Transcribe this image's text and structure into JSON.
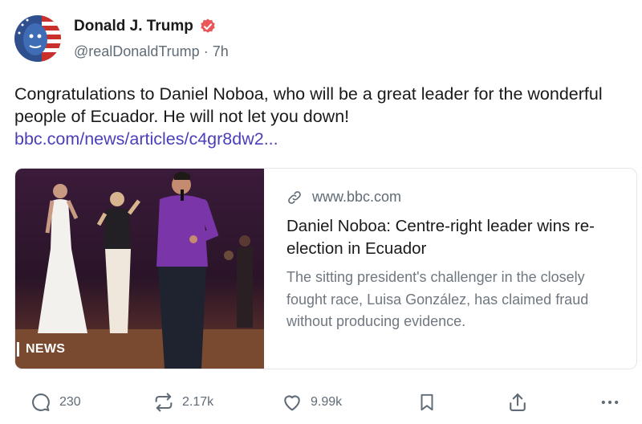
{
  "post": {
    "author_name": "Donald J. Trump",
    "handle": "@realDonaldTrump",
    "time": "7h",
    "text": "Congratulations to Daniel Noboa, who will be a great leader for the wonderful people of Ecuador. He will not let you down!",
    "link": "bbc.com/news/articles/c4gr8dw2..."
  },
  "card": {
    "domain": "www.bbc.com",
    "title": "Daniel Noboa: Centre-right leader wins re-election in Ecuador",
    "description": "The sitting president's challenger in the closely fought race, Luisa González, has claimed fraud without producing evidence.",
    "image_badge": "NEWS"
  },
  "actions": {
    "replies": "230",
    "reposts": "2.17k",
    "likes": "9.99k"
  },
  "colors": {
    "verified": "#e9575b",
    "link": "#4a3fb8"
  }
}
